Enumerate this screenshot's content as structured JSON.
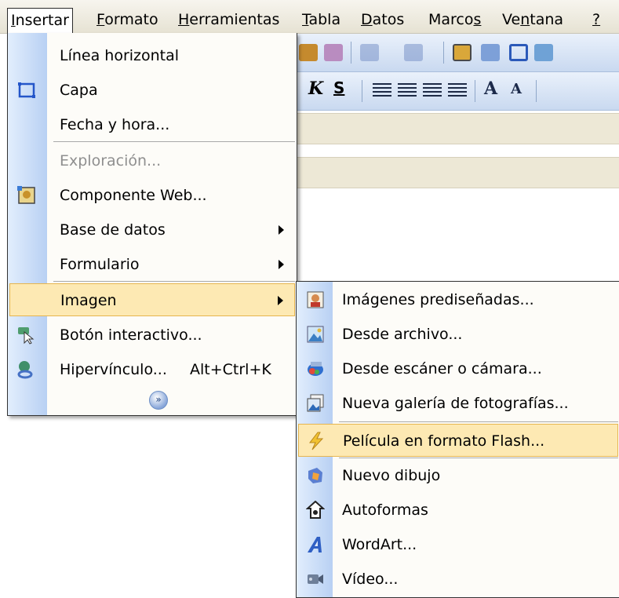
{
  "menubar": {
    "items": [
      {
        "label": "Insertar",
        "mnemonic": "I"
      },
      {
        "label": "Formato",
        "mnemonic": "F"
      },
      {
        "label": "Herramientas",
        "mnemonic": "H"
      },
      {
        "label": "Tabla",
        "mnemonic": "T"
      },
      {
        "label": "Datos",
        "mnemonic": "D"
      },
      {
        "label": "Marcos",
        "mnemonic": "s"
      },
      {
        "label": "Ventana",
        "mnemonic": "n"
      },
      {
        "label": "?",
        "mnemonic": "?"
      }
    ]
  },
  "toolbar": {
    "format_buttons": [
      "K",
      "S"
    ]
  },
  "insert_menu": {
    "items": [
      {
        "label": "Línea horizontal",
        "icon": "none"
      },
      {
        "label": "Capa",
        "icon": "layer-icon"
      },
      {
        "label": "Fecha y hora...",
        "icon": "none"
      },
      {
        "label": "Exploración...",
        "icon": "none",
        "disabled": true
      },
      {
        "label": "Componente Web...",
        "icon": "web-component-icon"
      },
      {
        "label": "Base de datos",
        "icon": "none",
        "submenu": true
      },
      {
        "label": "Formulario",
        "icon": "none",
        "submenu": true
      },
      {
        "label": "Imagen",
        "icon": "none",
        "submenu": true,
        "highlighted": true
      },
      {
        "label": "Botón interactivo...",
        "icon": "interactive-button-icon"
      },
      {
        "label": "Hipervínculo...",
        "shortcut": "Alt+Ctrl+K",
        "icon": "hyperlink-icon"
      }
    ],
    "expand_icon": "expand-chevrons-icon"
  },
  "image_submenu": {
    "items": [
      {
        "label": "Imágenes prediseñadas...",
        "icon": "clipart-icon"
      },
      {
        "label": "Desde archivo...",
        "icon": "picture-file-icon"
      },
      {
        "label": "Desde escáner o cámara...",
        "icon": "scanner-camera-icon"
      },
      {
        "label": "Nueva galería de fotografías...",
        "icon": "photo-gallery-icon"
      },
      {
        "label": "Película en formato Flash...",
        "icon": "flash-icon",
        "highlighted": true
      },
      {
        "label": "Nuevo dibujo",
        "icon": "new-drawing-icon"
      },
      {
        "label": "Autoformas",
        "icon": "autoshapes-icon"
      },
      {
        "label": "WordArt...",
        "icon": "wordart-icon"
      },
      {
        "label": "Vídeo...",
        "icon": "video-icon"
      }
    ]
  }
}
